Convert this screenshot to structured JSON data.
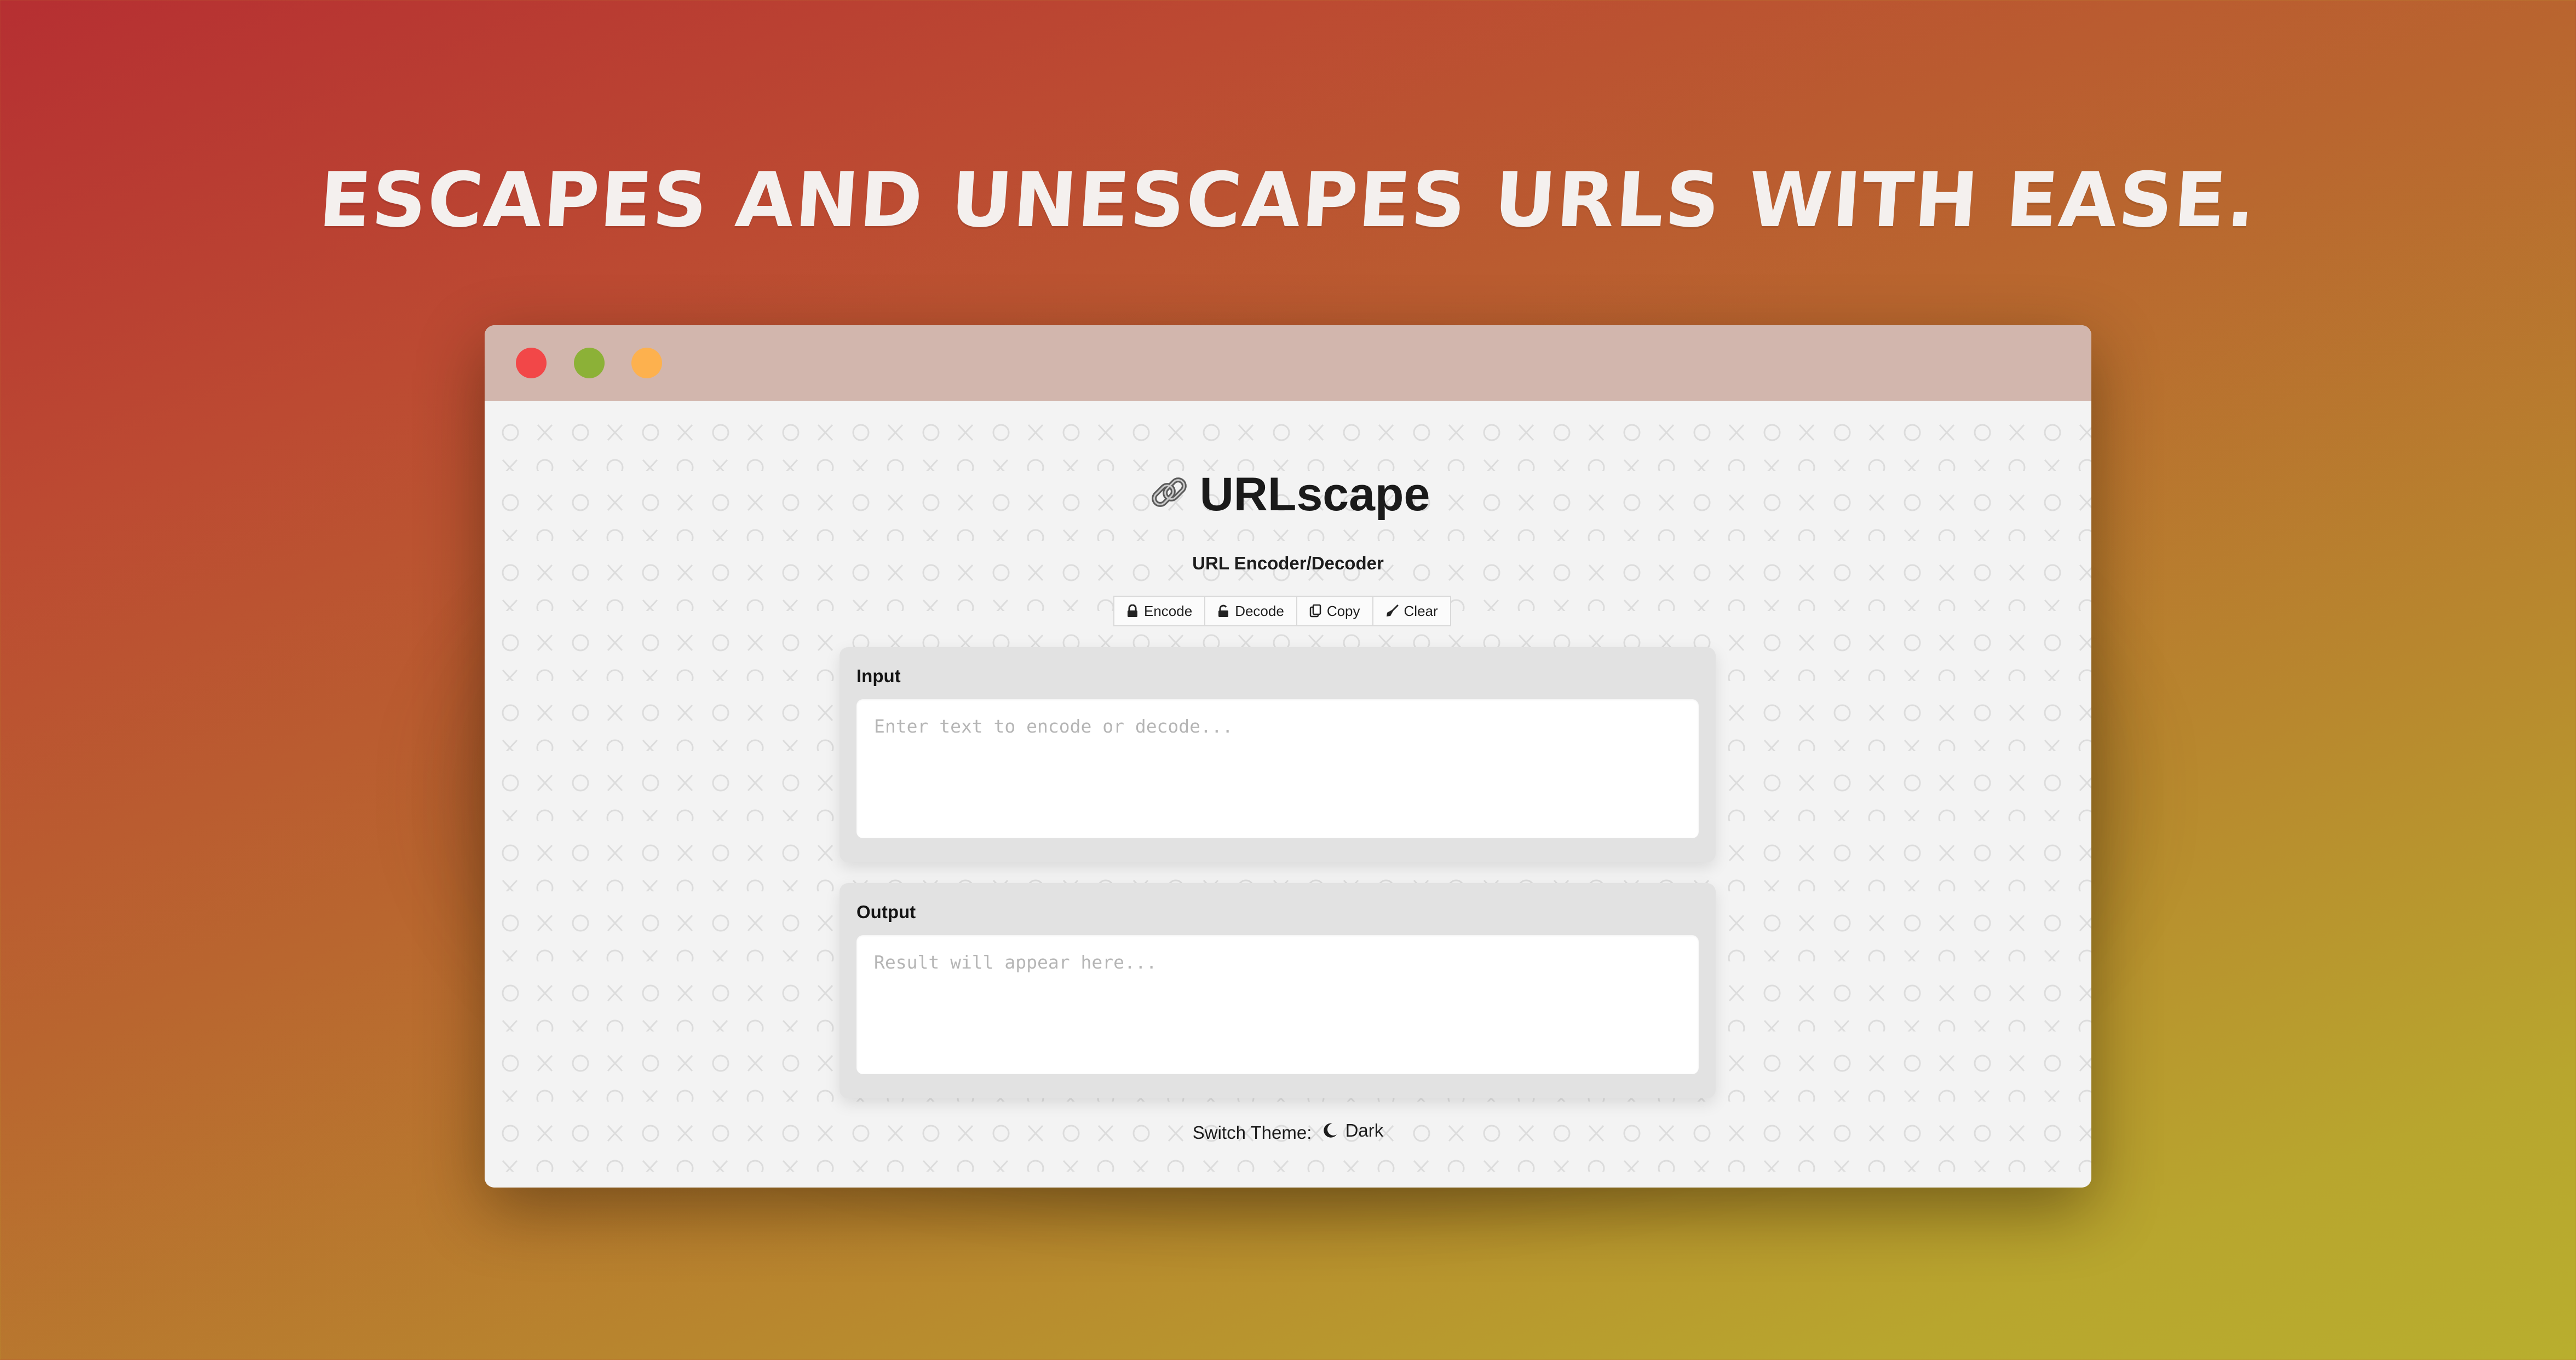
{
  "headline": "Escapes and unescapes URLs with ease.",
  "window": {
    "controls": [
      "close",
      "minimize",
      "maximize"
    ],
    "colors": {
      "close": "#f24748",
      "minimize": "#8cb137",
      "maximize": "#fdb14e"
    }
  },
  "app": {
    "title": "URLscape",
    "title_icon": "link-icon",
    "subtitle": "URL Encoder/Decoder"
  },
  "toolbar": {
    "encode_label": "Encode",
    "decode_label": "Decode",
    "copy_label": "Copy",
    "clear_label": "Clear"
  },
  "input_panel": {
    "label": "Input",
    "value": "",
    "placeholder": "Enter text to encode or decode..."
  },
  "output_panel": {
    "label": "Output",
    "value": "",
    "placeholder": "Result will appear here..."
  },
  "theme": {
    "label": "Switch Theme:",
    "option": "Dark",
    "icon": "moon-icon"
  }
}
